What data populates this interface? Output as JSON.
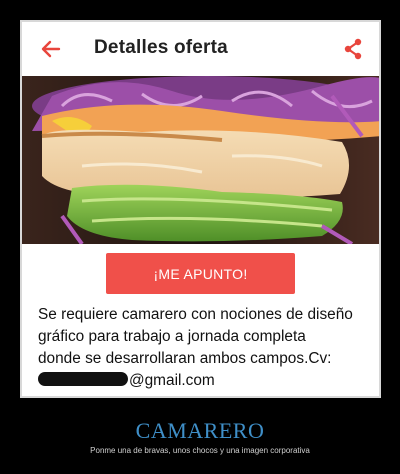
{
  "app": {
    "title": "Detalles oferta",
    "accent_color": "#e8453c",
    "back_icon": "arrow-left-icon",
    "share_icon": "share-icon"
  },
  "offer": {
    "image_alt": "sandwich",
    "cta_label": "¡ME APUNTO!",
    "cta_color": "#f0504a",
    "description_line1": "Se requiere camarero con nociones de diseño",
    "description_line2": "gráfico para trabajo a jornada completa",
    "description_line3": "donde se desarrollaran ambos campos.Cv:",
    "email_suffix": "@gmail.com"
  },
  "caption": {
    "title": "CAMARERO",
    "subtitle": "Ponme una de bravas, unos chocos y una imagen corporativa",
    "title_color": "#3f8fc8"
  }
}
